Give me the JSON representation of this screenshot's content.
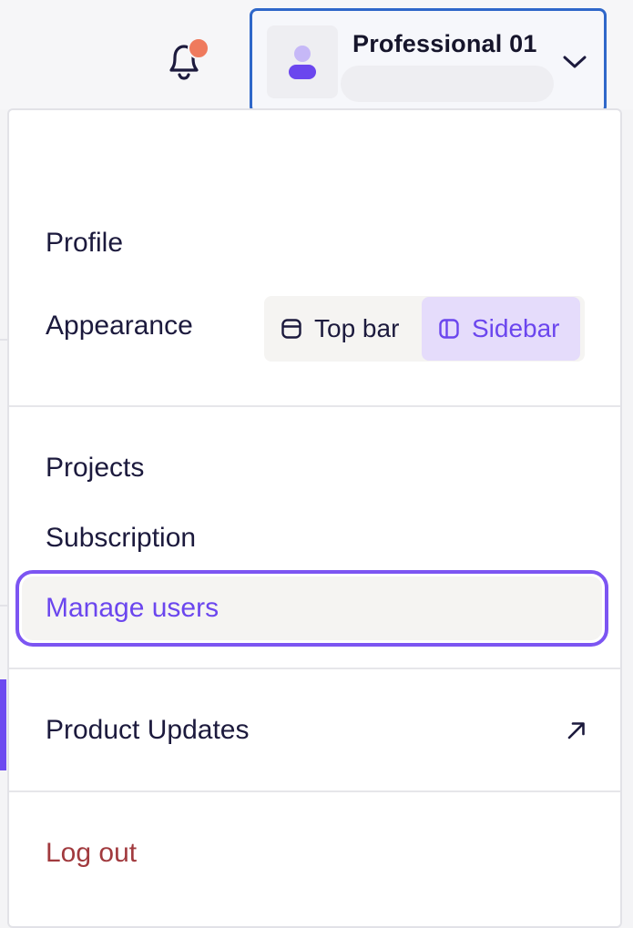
{
  "header": {
    "account": {
      "name": "Professional 01"
    }
  },
  "menu": {
    "profile": "Profile",
    "appearance": {
      "label": "Appearance",
      "options": [
        "Top bar",
        "Sidebar"
      ],
      "selected": "Sidebar"
    },
    "projects": "Projects",
    "subscription": "Subscription",
    "manage_users": "Manage users",
    "product_updates": "Product Updates",
    "logout": "Log out"
  },
  "colors": {
    "accent": "#6b46ee",
    "focus_ring": "#7c55f2",
    "account_border": "#2f67c9",
    "notification_dot": "#ef7a5d",
    "danger_text": "#a13a3e"
  },
  "icons": {
    "notification": "bell-icon",
    "avatar": "user-icon",
    "account_toggle": "chevron-down-icon",
    "top_bar_option": "layout-top-bar-icon",
    "sidebar_option": "layout-sidebar-icon",
    "external_link": "arrow-up-right-icon"
  }
}
